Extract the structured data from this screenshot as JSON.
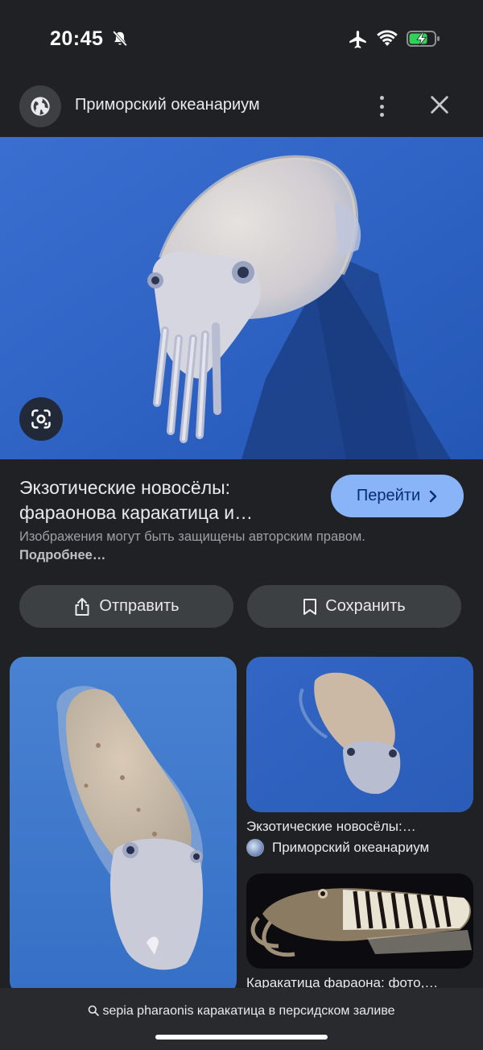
{
  "status_bar": {
    "time": "20:45",
    "icons": [
      "bell-off-icon",
      "airplane-icon",
      "wifi-icon",
      "battery-charging-icon"
    ]
  },
  "header": {
    "site_name": "Приморский океанариум",
    "icons": [
      "globe-icon",
      "more-vert-icon",
      "close-icon"
    ]
  },
  "result": {
    "title_line1": "Экзотические новосёлы:",
    "title_line2": "фараонова каракатица и…",
    "visit_label": "Перейти",
    "copyright_text": "Изображения могут быть защищены авторским правом.",
    "more_link": "Подробнее…"
  },
  "actions": {
    "share_label": "Отправить",
    "save_label": "Сохранить"
  },
  "related": {
    "item1_caption": "Экзотические новосёлы:…",
    "item1_source": "Приморский океанариум",
    "item2_caption": "Каракатица фараона: фото,…"
  },
  "search": {
    "query": "sepia pharaonis каракатица в персидском заливе"
  },
  "colors": {
    "background": "#202124",
    "accent": "#8ab4f8",
    "button_bg": "#3c4043",
    "image_water": "#2f63c4"
  }
}
